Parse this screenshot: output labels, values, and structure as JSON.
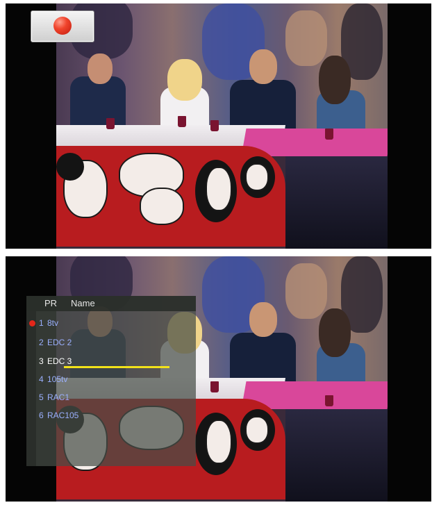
{
  "top_screen": {
    "status_icon": "record-icon",
    "record_color": "#e3261a"
  },
  "channel_list": {
    "columns": {
      "pr": "PR",
      "name": "Name"
    },
    "selected_index": 2,
    "recording_index": 0,
    "highlight_color": "#f2e21a",
    "text_color": "#9bb0ff",
    "channels": [
      {
        "number": "1",
        "name": "8tv"
      },
      {
        "number": "2",
        "name": "EDC 2"
      },
      {
        "number": "3",
        "name": "EDC 3"
      },
      {
        "number": "4",
        "name": "105tv"
      },
      {
        "number": "5",
        "name": "RAC1"
      },
      {
        "number": "6",
        "name": "RAC105"
      }
    ]
  }
}
